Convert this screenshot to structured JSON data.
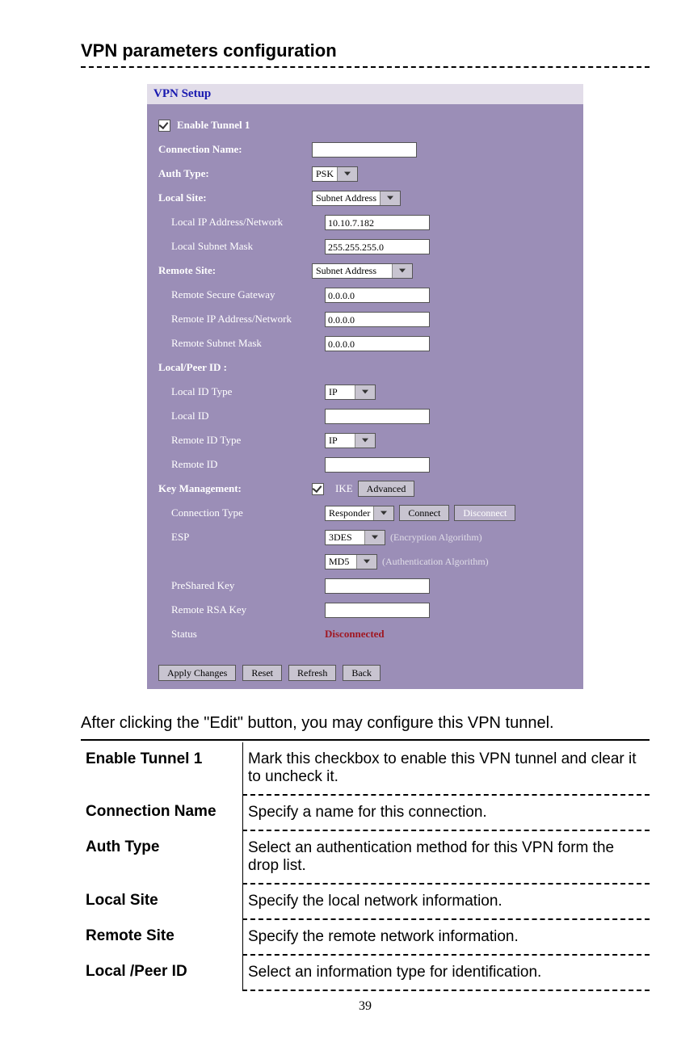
{
  "page_title": "VPN parameters configuration",
  "page_number": "39",
  "caption": "After clicking the \"Edit\" button, you may configure this VPN tunnel.",
  "vpn": {
    "panel_title": "VPN Setup",
    "enable_label": "Enable Tunnel  1",
    "enable_checked": true,
    "fields": {
      "connection_name": {
        "label": "Connection Name:",
        "value": ""
      },
      "auth_type": {
        "label": "Auth Type:",
        "value": "PSK"
      },
      "local_site": {
        "label": "Local Site:",
        "value": "Subnet Address"
      },
      "local_ip": {
        "label": "Local IP Address/Network",
        "value": "10.10.7.182"
      },
      "local_mask": {
        "label": "Local Subnet Mask",
        "value": "255.255.255.0"
      },
      "remote_site": {
        "label": "Remote Site:",
        "value": "Subnet Address"
      },
      "remote_gw": {
        "label": "Remote Secure Gateway",
        "value": "0.0.0.0"
      },
      "remote_ip": {
        "label": "Remote IP Address/Network",
        "value": "0.0.0.0"
      },
      "remote_mask": {
        "label": "Remote Subnet Mask",
        "value": "0.0.0.0"
      },
      "local_peer_head": "Local/Peer ID :",
      "local_id_type": {
        "label": "Local ID Type",
        "value": "IP"
      },
      "local_id": {
        "label": "Local ID",
        "value": ""
      },
      "remote_id_type": {
        "label": "Remote ID Type",
        "value": "IP"
      },
      "remote_id": {
        "label": "Remote ID",
        "value": ""
      },
      "key_mgmt_head": "Key Management:",
      "ike_label": "IKE",
      "ike_checked": true,
      "advanced_btn": "Advanced",
      "conn_type": {
        "label": "Connection Type",
        "value": "Responder"
      },
      "connect_btn": "Connect",
      "disconnect_btn": "Disconnect",
      "esp_label": "ESP",
      "esp_enc": {
        "value": "3DES",
        "note": "(Encryption Algorithm)"
      },
      "esp_auth": {
        "value": "MD5",
        "note": "(Authentication Algorithm)"
      },
      "preshared": {
        "label": "PreShared Key",
        "value": ""
      },
      "remote_rsa": {
        "label": "Remote RSA Key",
        "value": ""
      },
      "status": {
        "label": "Status",
        "value": "Disconnected"
      }
    },
    "footer": {
      "apply": "Apply Changes",
      "reset": "Reset",
      "refresh": "Refresh",
      "back": "Back"
    }
  },
  "table": [
    {
      "k": "Enable Tunnel 1",
      "v": "Mark this checkbox to enable this VPN tunnel and clear it to uncheck it."
    },
    {
      "k": "Connection Name",
      "v": "Specify a name for this connection."
    },
    {
      "k": "Auth Type",
      "v": "Select an authentication method for this VPN form the drop list."
    },
    {
      "k": "Local Site",
      "v": "Specify the local network information."
    },
    {
      "k": "Remote Site",
      "v": "Specify the remote network information."
    },
    {
      "k": "Local /Peer ID",
      "v": "Select an information type for identification."
    }
  ]
}
